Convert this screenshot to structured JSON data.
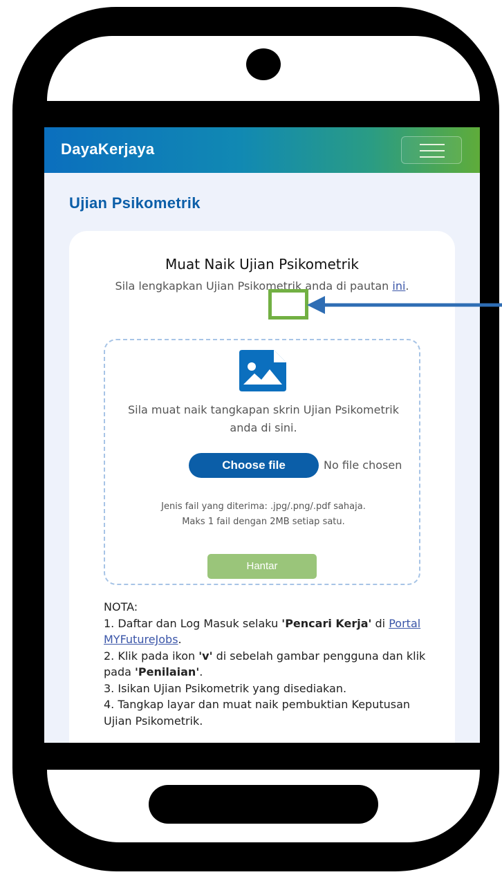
{
  "colors": {
    "navbar_gradient_start": "#0b6fbe",
    "navbar_gradient_end": "#5fac3a",
    "primary": "#0b5ea8",
    "submit_button": "#9ac57a",
    "highlight": "#72b043",
    "arrow": "#2e6db4",
    "link": "#3a55a8"
  },
  "navbar": {
    "brand": "DayaKerjaya",
    "menu_icon": "hamburger-menu-icon"
  },
  "page": {
    "title": "Ujian Psikometrik"
  },
  "card": {
    "title": "Muat Naik Ujian Psikometrik",
    "subtitle_prefix": "Sila lengkapkan Ujian Psikometrik anda di pautan ",
    "subtitle_link": "ini",
    "subtitle_suffix": "."
  },
  "upload": {
    "icon": "image-file-icon",
    "instruction": "Sila muat naik tangkapan skrin Ujian Psikometrik anda di sini.",
    "choose_button": "Choose file",
    "file_status": "No file chosen",
    "accepted_types": "Jenis fail yang diterima: .jpg/.png/.pdf sahaja.",
    "max_size": "Maks 1 fail dengan 2MB setiap satu.",
    "submit_button": "Hantar"
  },
  "nota": {
    "heading": "NOTA:",
    "step1_a": "1. Daftar dan Log Masuk selaku ",
    "step1_b": "'Pencari Kerja'",
    "step1_c": " di ",
    "step1_link": "Portal MYFutureJobs",
    "step1_d": ".",
    "step2_a": "2. Klik pada ikon ",
    "step2_b": "'v'",
    "step2_c": " di sebelah gambar pengguna dan klik pada ",
    "step2_d": "'Penilaian'",
    "step2_e": ".",
    "step3": "3. Isikan Ujian Psikometrik yang disediakan.",
    "step4": "4. Tangkap layar dan muat naik pembuktian Keputusan Ujian Psikometrik."
  }
}
